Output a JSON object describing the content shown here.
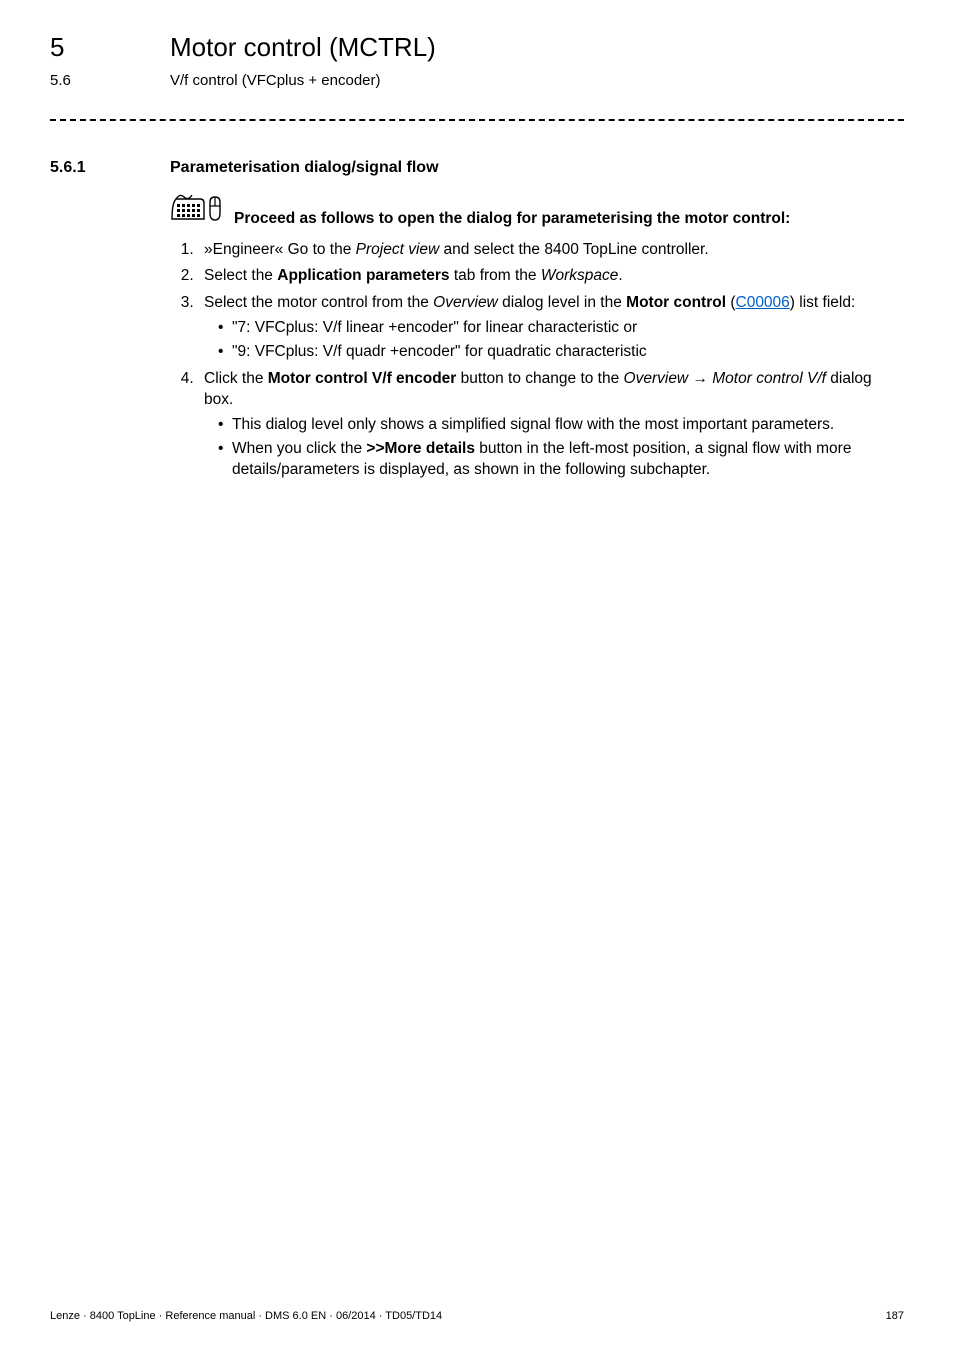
{
  "header": {
    "chapter_num": "5",
    "chapter_title": "Motor control (MCTRL)",
    "section_num": "5.6",
    "section_title": "V/f control (VFCplus + encoder)"
  },
  "section": {
    "num": "5.6.1",
    "title": "Parameterisation dialog/signal flow"
  },
  "proceed": "Proceed as follows to open the dialog for parameterising the motor control:",
  "steps": {
    "s1_a": "»Engineer« Go to the ",
    "s1_b": "Project view",
    "s1_c": " and select the 8400 TopLine controller.",
    "s2_a": "Select the ",
    "s2_b": "Application parameters",
    "s2_c": " tab from the ",
    "s2_d": "Workspace",
    "s2_e": ".",
    "s3_a": "Select the motor control from the ",
    "s3_b": "Overview",
    "s3_c": " dialog level in the ",
    "s3_d": "Motor control",
    "s3_e": " (",
    "s3_link": "C00006",
    "s3_f": ") list field:",
    "s3_sub1": "\"7: VFCplus: V/f linear +encoder\" for linear characteristic or",
    "s3_sub2": "\"9: VFCplus: V/f quadr +encoder\" for quadratic characteristic",
    "s4_a": "Click the ",
    "s4_b": "Motor control V/f encoder",
    "s4_c": " button to change to the ",
    "s4_d": "Overview",
    "s4_arrow": "  ",
    "s4_e": "Motor control V/f",
    "s4_f": " dialog box.",
    "s4_sub1": "This dialog level only shows a simplified signal flow with the most important parameters.",
    "s4_sub2_a": "When you click the ",
    "s4_sub2_b": ">>More details",
    "s4_sub2_c": " button in the left-most position, a signal flow with more details/parameters is displayed, as shown in the following subchapter."
  },
  "footer": {
    "left": "Lenze · 8400 TopLine · Reference manual · DMS 6.0 EN · 06/2014 · TD05/TD14",
    "right": "187"
  }
}
